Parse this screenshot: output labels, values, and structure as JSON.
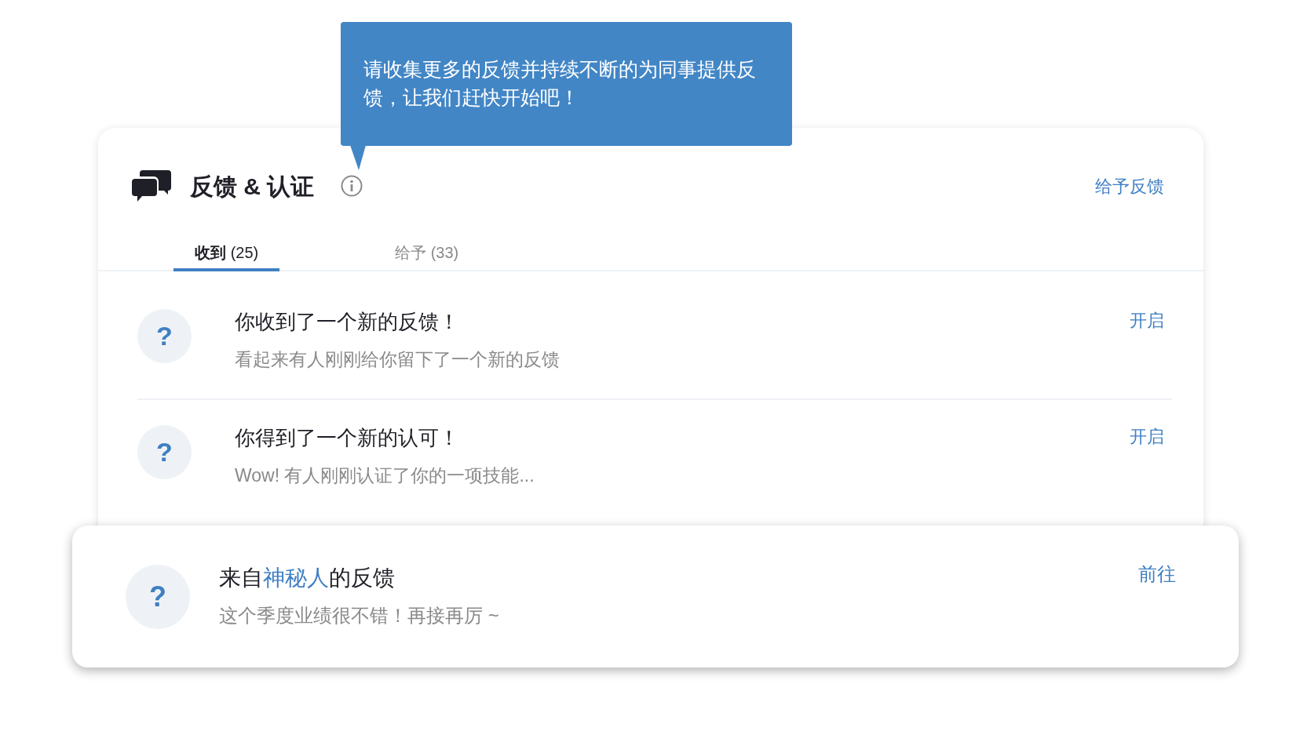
{
  "tooltip": {
    "text": "请收集更多的反馈并持续不断的为同事提供反馈，让我们赶快开始吧！"
  },
  "header": {
    "title": "反馈 & 认证",
    "action": "给予反馈"
  },
  "tabs": [
    {
      "label": "收到",
      "count": "(25)",
      "selected": true
    },
    {
      "label": "给予",
      "count": "(33)",
      "selected": false
    }
  ],
  "items": [
    {
      "avatar": "?",
      "title": "你收到了一个新的反馈！",
      "subtitle": "看起来有人刚刚给你留下了一个新的反馈",
      "action": "开启"
    },
    {
      "avatar": "?",
      "title": "你得到了一个新的认可！",
      "subtitle": "Wow! 有人刚刚认证了你的一项技能...",
      "action": "开启"
    }
  ],
  "popup": {
    "avatar": "?",
    "title": [
      {
        "text": "来自",
        "highlight": false
      },
      {
        "text": "神秘人",
        "highlight": true
      },
      {
        "text": "的反馈",
        "highlight": false
      }
    ],
    "subtitle": "这个季度业绩很不错！再接再厉 ~",
    "action": "前往"
  }
}
